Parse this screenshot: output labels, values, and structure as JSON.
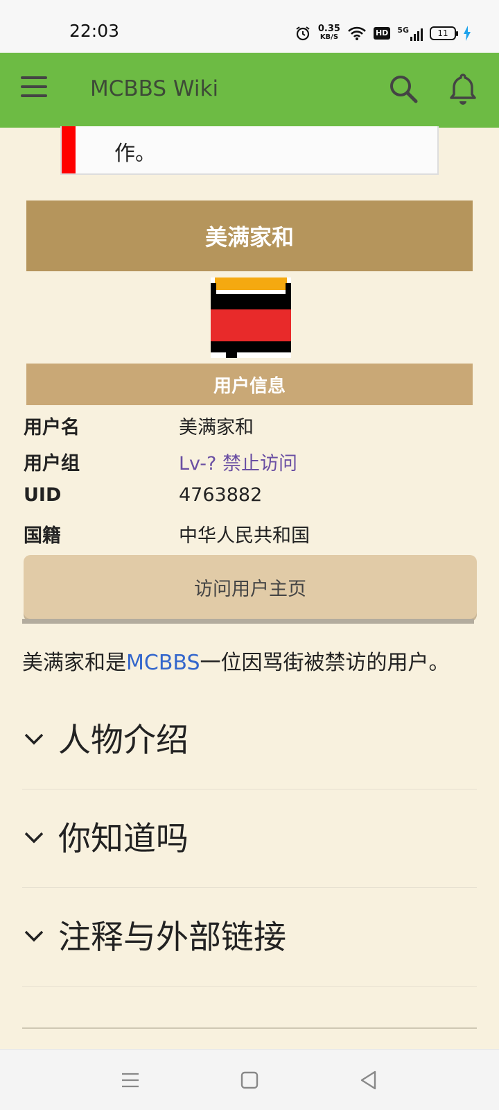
{
  "status_bar": {
    "time": "22:03",
    "net_speed": "0.35",
    "net_unit": "KB/S",
    "hd": "HD",
    "signal": "5G",
    "battery": "11"
  },
  "app_bar": {
    "title": "MCBBS Wiki"
  },
  "notice": {
    "text": "作。",
    "accent_color": "#ff0000"
  },
  "infobox": {
    "title": "美满家和",
    "section_title": "用户信息",
    "rows": [
      {
        "label": "用户名",
        "value": "美满家和"
      },
      {
        "label": "用户组",
        "value": "Lv-? 禁止访问"
      },
      {
        "label": "UID",
        "value": "4763882"
      },
      {
        "label": "国籍",
        "value": "中华人民共和国"
      }
    ],
    "visit_button": "访问用户主页"
  },
  "intro": {
    "prefix": "美满家和是",
    "link": "MCBBS",
    "suffix": "一位因骂街被禁访的用户。"
  },
  "sections": [
    {
      "title": "人物介绍"
    },
    {
      "title": "你知道吗"
    },
    {
      "title": "注释与外部链接"
    }
  ],
  "colors": {
    "app_bar": "#6dbb44",
    "page_bg": "#f8f1de",
    "infobox_title": "#b5955c",
    "infobox_section": "#c9a876",
    "link": "#3366cc"
  }
}
